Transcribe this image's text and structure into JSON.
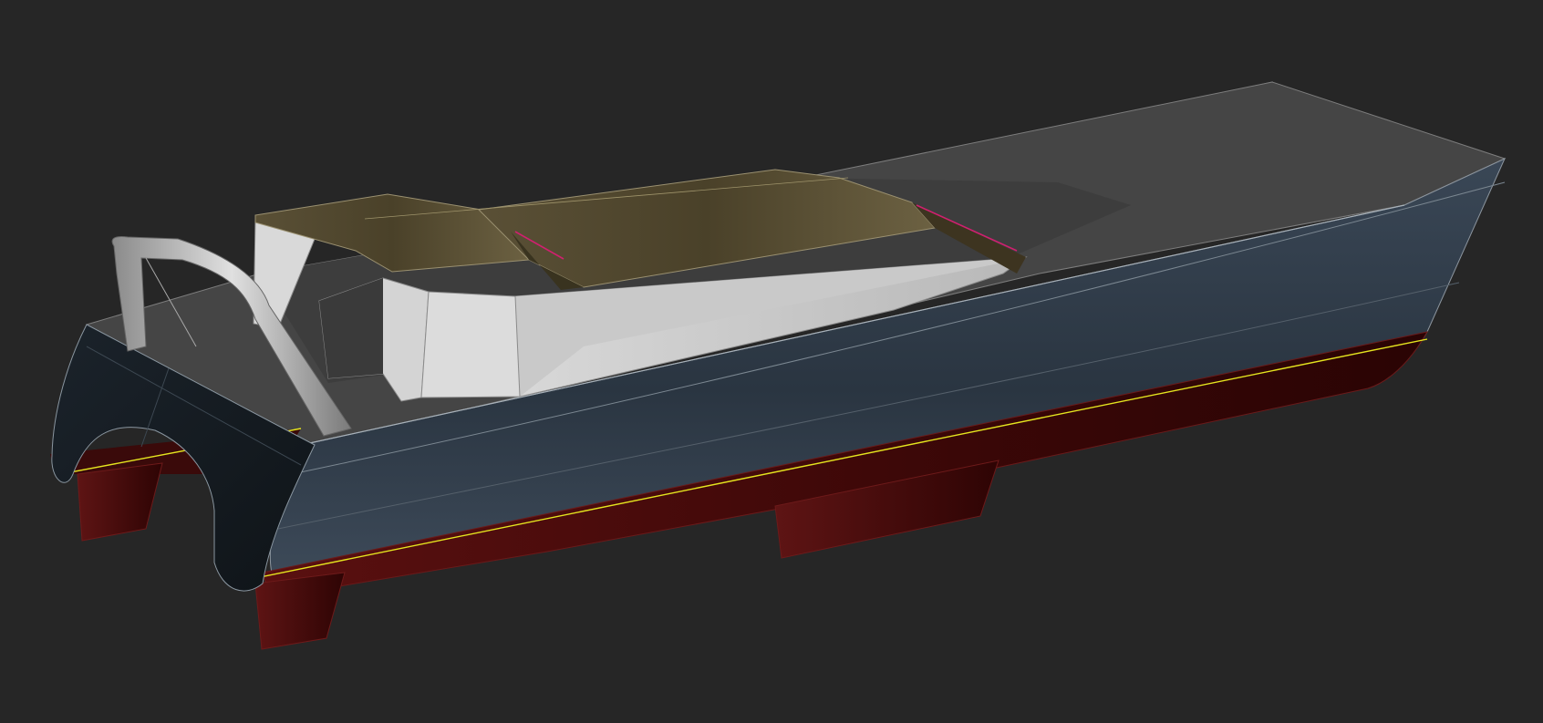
{
  "viewport": {
    "background": "#262626"
  },
  "model": {
    "type": "catamaran-hull",
    "colors": {
      "hull_top": "#2e3a47",
      "hull_mid": "#3b4856",
      "hull_shadow": "#151c22",
      "transom": "#12181d",
      "antifouling": "#4a0c0c",
      "antifouling_dark": "#2a0505",
      "deck": "#4a4a4a",
      "deck_dark": "#3a3a3a",
      "cabin_white": "#d2d2d2",
      "cabin_shade": "#aeaeae",
      "roof_olive": "#4e4530",
      "roof_olive_light": "#6b5f3e",
      "edge_line": "#9aa3ab",
      "waterline": "#e5e51f",
      "highlight_magenta": "#d0206f"
    }
  }
}
